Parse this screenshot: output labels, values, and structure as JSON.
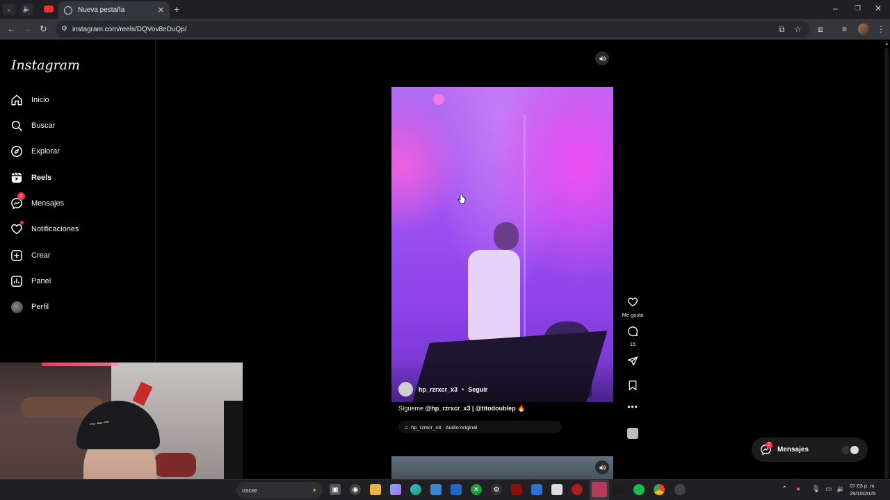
{
  "browser": {
    "tab_title": "Nueva pestaña",
    "url": "instagram.com/reels/DQVov8eDuQp/"
  },
  "sidebar": {
    "logo": "Instagram",
    "items": [
      {
        "label": "Inicio",
        "icon": "home-icon"
      },
      {
        "label": "Buscar",
        "icon": "search-icon"
      },
      {
        "label": "Explorar",
        "icon": "compass-icon"
      },
      {
        "label": "Reels",
        "icon": "reels-icon",
        "active": true
      },
      {
        "label": "Mensajes",
        "icon": "messenger-icon",
        "badge": "2"
      },
      {
        "label": "Notificaciones",
        "icon": "heart-icon",
        "dot": true
      },
      {
        "label": "Crear",
        "icon": "plus-square-icon"
      },
      {
        "label": "Panel",
        "icon": "bar-chart-icon"
      },
      {
        "label": "Perfil",
        "icon": "profile-avatar"
      }
    ]
  },
  "reel": {
    "username": "hp_rzrxcr_x3",
    "separator": "•",
    "follow_label": "Seguir",
    "caption_prefix": "Sígueme ",
    "caption_handles": "@hp_rzrxcr_x3 | @titodoublep",
    "caption_emoji": "🔥",
    "audio": "hp_rzrxcr_x3 · Audio original"
  },
  "actions": {
    "like_label": "Me gusta",
    "comments_count": "15"
  },
  "messages_float": {
    "label": "Mensajes",
    "badge": "2"
  },
  "taskbar": {
    "search_text": "uscar",
    "time": "07:03 p. m.",
    "date": "29/10/2025"
  },
  "colors": {
    "accent_badge": "#ff3040",
    "background": "#000000"
  }
}
